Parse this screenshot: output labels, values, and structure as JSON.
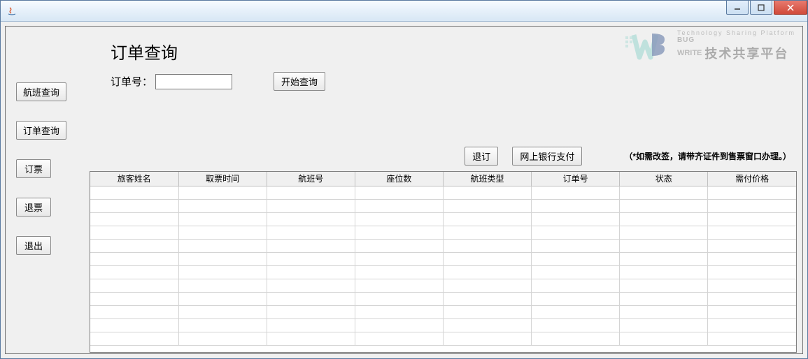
{
  "window": {
    "title": ""
  },
  "watermark": {
    "small": "Technology Sharing Platform",
    "bug": "BUG",
    "write": "WRITE",
    "big": "技术共享平台"
  },
  "sidebar": {
    "items": [
      {
        "label": "航班查询"
      },
      {
        "label": "订单查询"
      },
      {
        "label": "订票"
      },
      {
        "label": "退票"
      },
      {
        "label": "退出"
      }
    ]
  },
  "main": {
    "title": "订单查询",
    "order_label": "订单号：",
    "order_value": "",
    "search_btn": "开始查询",
    "cancel_btn": "退订",
    "pay_btn": "网上银行支付",
    "notice": "（*如需改签，请带齐证件到售票窗口办理。）"
  },
  "table": {
    "headers": [
      "旅客姓名",
      "取票时间",
      "航班号",
      "座位数",
      "航班类型",
      "订单号",
      "状态",
      "需付价格"
    ],
    "row_count": 12
  }
}
